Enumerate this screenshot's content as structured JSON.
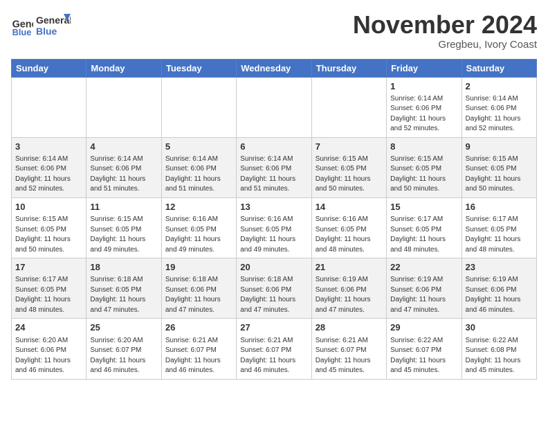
{
  "header": {
    "logo_general": "General",
    "logo_blue": "Blue",
    "month_title": "November 2024",
    "subtitle": "Gregbeu, Ivory Coast"
  },
  "weekdays": [
    "Sunday",
    "Monday",
    "Tuesday",
    "Wednesday",
    "Thursday",
    "Friday",
    "Saturday"
  ],
  "weeks": [
    [
      {
        "day": "",
        "info": ""
      },
      {
        "day": "",
        "info": ""
      },
      {
        "day": "",
        "info": ""
      },
      {
        "day": "",
        "info": ""
      },
      {
        "day": "",
        "info": ""
      },
      {
        "day": "1",
        "info": "Sunrise: 6:14 AM\nSunset: 6:06 PM\nDaylight: 11 hours\nand 52 minutes."
      },
      {
        "day": "2",
        "info": "Sunrise: 6:14 AM\nSunset: 6:06 PM\nDaylight: 11 hours\nand 52 minutes."
      }
    ],
    [
      {
        "day": "3",
        "info": "Sunrise: 6:14 AM\nSunset: 6:06 PM\nDaylight: 11 hours\nand 52 minutes."
      },
      {
        "day": "4",
        "info": "Sunrise: 6:14 AM\nSunset: 6:06 PM\nDaylight: 11 hours\nand 51 minutes."
      },
      {
        "day": "5",
        "info": "Sunrise: 6:14 AM\nSunset: 6:06 PM\nDaylight: 11 hours\nand 51 minutes."
      },
      {
        "day": "6",
        "info": "Sunrise: 6:14 AM\nSunset: 6:06 PM\nDaylight: 11 hours\nand 51 minutes."
      },
      {
        "day": "7",
        "info": "Sunrise: 6:15 AM\nSunset: 6:05 PM\nDaylight: 11 hours\nand 50 minutes."
      },
      {
        "day": "8",
        "info": "Sunrise: 6:15 AM\nSunset: 6:05 PM\nDaylight: 11 hours\nand 50 minutes."
      },
      {
        "day": "9",
        "info": "Sunrise: 6:15 AM\nSunset: 6:05 PM\nDaylight: 11 hours\nand 50 minutes."
      }
    ],
    [
      {
        "day": "10",
        "info": "Sunrise: 6:15 AM\nSunset: 6:05 PM\nDaylight: 11 hours\nand 50 minutes."
      },
      {
        "day": "11",
        "info": "Sunrise: 6:15 AM\nSunset: 6:05 PM\nDaylight: 11 hours\nand 49 minutes."
      },
      {
        "day": "12",
        "info": "Sunrise: 6:16 AM\nSunset: 6:05 PM\nDaylight: 11 hours\nand 49 minutes."
      },
      {
        "day": "13",
        "info": "Sunrise: 6:16 AM\nSunset: 6:05 PM\nDaylight: 11 hours\nand 49 minutes."
      },
      {
        "day": "14",
        "info": "Sunrise: 6:16 AM\nSunset: 6:05 PM\nDaylight: 11 hours\nand 48 minutes."
      },
      {
        "day": "15",
        "info": "Sunrise: 6:17 AM\nSunset: 6:05 PM\nDaylight: 11 hours\nand 48 minutes."
      },
      {
        "day": "16",
        "info": "Sunrise: 6:17 AM\nSunset: 6:05 PM\nDaylight: 11 hours\nand 48 minutes."
      }
    ],
    [
      {
        "day": "17",
        "info": "Sunrise: 6:17 AM\nSunset: 6:05 PM\nDaylight: 11 hours\nand 48 minutes."
      },
      {
        "day": "18",
        "info": "Sunrise: 6:18 AM\nSunset: 6:05 PM\nDaylight: 11 hours\nand 47 minutes."
      },
      {
        "day": "19",
        "info": "Sunrise: 6:18 AM\nSunset: 6:06 PM\nDaylight: 11 hours\nand 47 minutes."
      },
      {
        "day": "20",
        "info": "Sunrise: 6:18 AM\nSunset: 6:06 PM\nDaylight: 11 hours\nand 47 minutes."
      },
      {
        "day": "21",
        "info": "Sunrise: 6:19 AM\nSunset: 6:06 PM\nDaylight: 11 hours\nand 47 minutes."
      },
      {
        "day": "22",
        "info": "Sunrise: 6:19 AM\nSunset: 6:06 PM\nDaylight: 11 hours\nand 47 minutes."
      },
      {
        "day": "23",
        "info": "Sunrise: 6:19 AM\nSunset: 6:06 PM\nDaylight: 11 hours\nand 46 minutes."
      }
    ],
    [
      {
        "day": "24",
        "info": "Sunrise: 6:20 AM\nSunset: 6:06 PM\nDaylight: 11 hours\nand 46 minutes."
      },
      {
        "day": "25",
        "info": "Sunrise: 6:20 AM\nSunset: 6:07 PM\nDaylight: 11 hours\nand 46 minutes."
      },
      {
        "day": "26",
        "info": "Sunrise: 6:21 AM\nSunset: 6:07 PM\nDaylight: 11 hours\nand 46 minutes."
      },
      {
        "day": "27",
        "info": "Sunrise: 6:21 AM\nSunset: 6:07 PM\nDaylight: 11 hours\nand 46 minutes."
      },
      {
        "day": "28",
        "info": "Sunrise: 6:21 AM\nSunset: 6:07 PM\nDaylight: 11 hours\nand 45 minutes."
      },
      {
        "day": "29",
        "info": "Sunrise: 6:22 AM\nSunset: 6:07 PM\nDaylight: 11 hours\nand 45 minutes."
      },
      {
        "day": "30",
        "info": "Sunrise: 6:22 AM\nSunset: 6:08 PM\nDaylight: 11 hours\nand 45 minutes."
      }
    ]
  ]
}
